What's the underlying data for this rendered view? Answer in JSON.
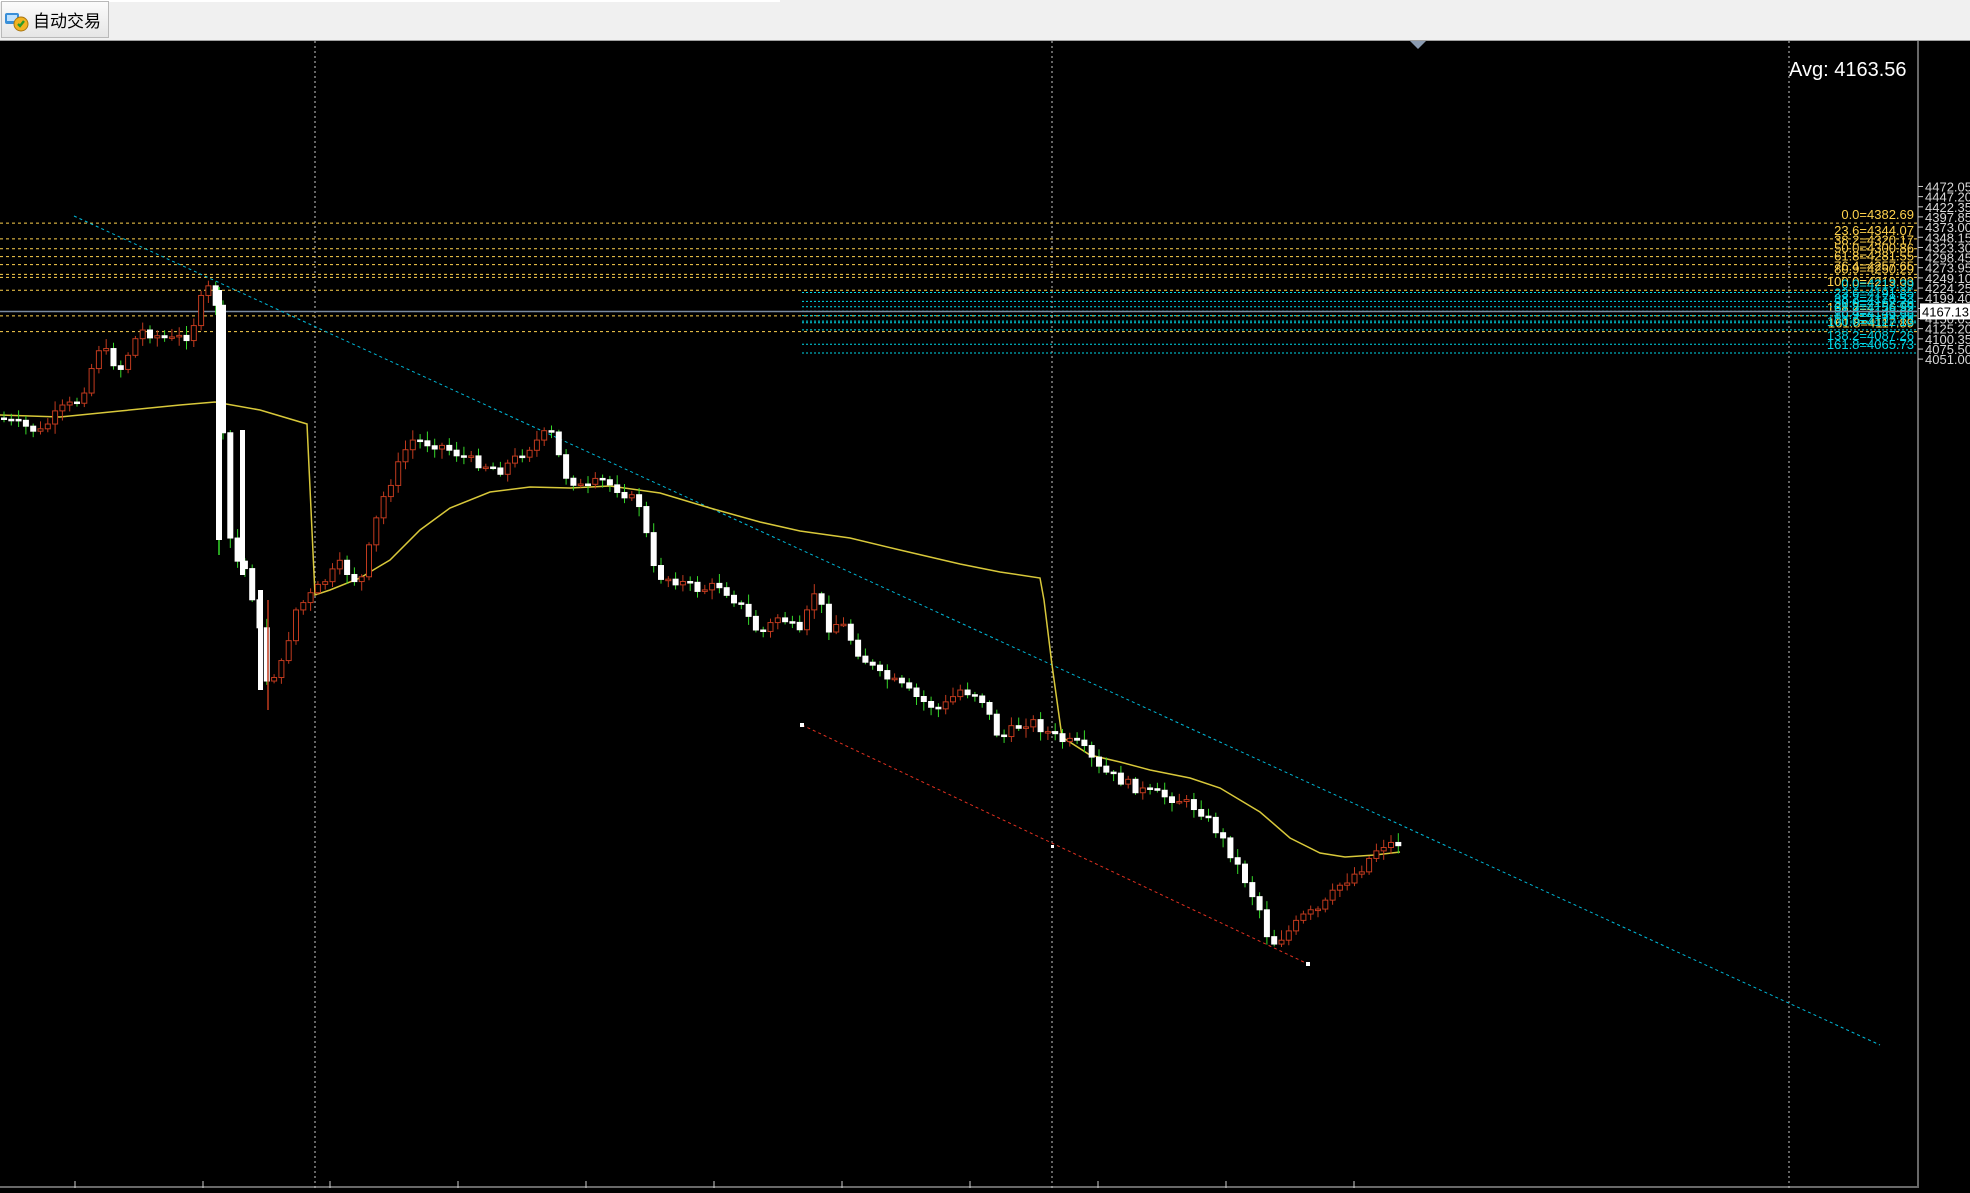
{
  "toolbar": {
    "auto_trading_label": "自动交易"
  },
  "avg_label": "Avg: 4163.56",
  "current_price": "4167.13",
  "colors": {
    "background": "#000000",
    "fib_gold": "#ffd24d",
    "fib_cyan": "#00d8e8",
    "candle_up": "#c03a1e",
    "candle_down": "#ffffff",
    "wick_down": "#36d82a",
    "ma_line": "#d8c83a",
    "trend_line": "#00b8d8"
  },
  "price_scale": [
    "4472.05",
    "4447.20",
    "4422.35",
    "4397.85",
    "4373.00",
    "4348.15",
    "4323.30",
    "4298.45",
    "4273.95",
    "4249.10",
    "4224.25",
    "4199.40",
    "4174.55",
    "4150.05",
    "4125.20",
    "4100.35",
    "4075.50",
    "4051.00"
  ],
  "fib_gold": [
    {
      "label": "0.0=4382.69",
      "price": 4382.69
    },
    {
      "label": "23.6=4344.07",
      "price": 4344.07
    },
    {
      "label": "38.2=4320.17",
      "price": 4320.17
    },
    {
      "label": "50.0=4300.86",
      "price": 4300.86
    },
    {
      "label": "61.8=4281.55",
      "price": 4281.55
    },
    {
      "label": "76.4=4257.65",
      "price": 4257.65
    },
    {
      "label": "80.9=4250.29",
      "price": 4250.29
    },
    {
      "label": "100.0=4219.03",
      "price": 4219.03
    },
    {
      "label": "138.2=4156.52",
      "price": 4156.52
    },
    {
      "label": "161.8=4117.89",
      "price": 4117.89
    }
  ],
  "fib_cyan": [
    {
      "label": "0.0=4213.39",
      "price": 4213.39
    },
    {
      "label": "23.6=4191.85",
      "price": 4191.85
    },
    {
      "label": "38.2=4178.53",
      "price": 4178.53
    },
    {
      "label": "50.0=4167.76",
      "price": 4167.76
    },
    {
      "label": "61.8=4156.99",
      "price": 4156.99
    },
    {
      "label": "76.4=4143.66",
      "price": 4143.66
    },
    {
      "label": "80.9=4139.56",
      "price": 4139.56
    },
    {
      "label": "100.0=4122.13",
      "price": 4122.13
    },
    {
      "label": "138.2=4087.26",
      "price": 4087.26
    },
    {
      "label": "161.8=4065.73",
      "price": 4065.73
    }
  ]
}
